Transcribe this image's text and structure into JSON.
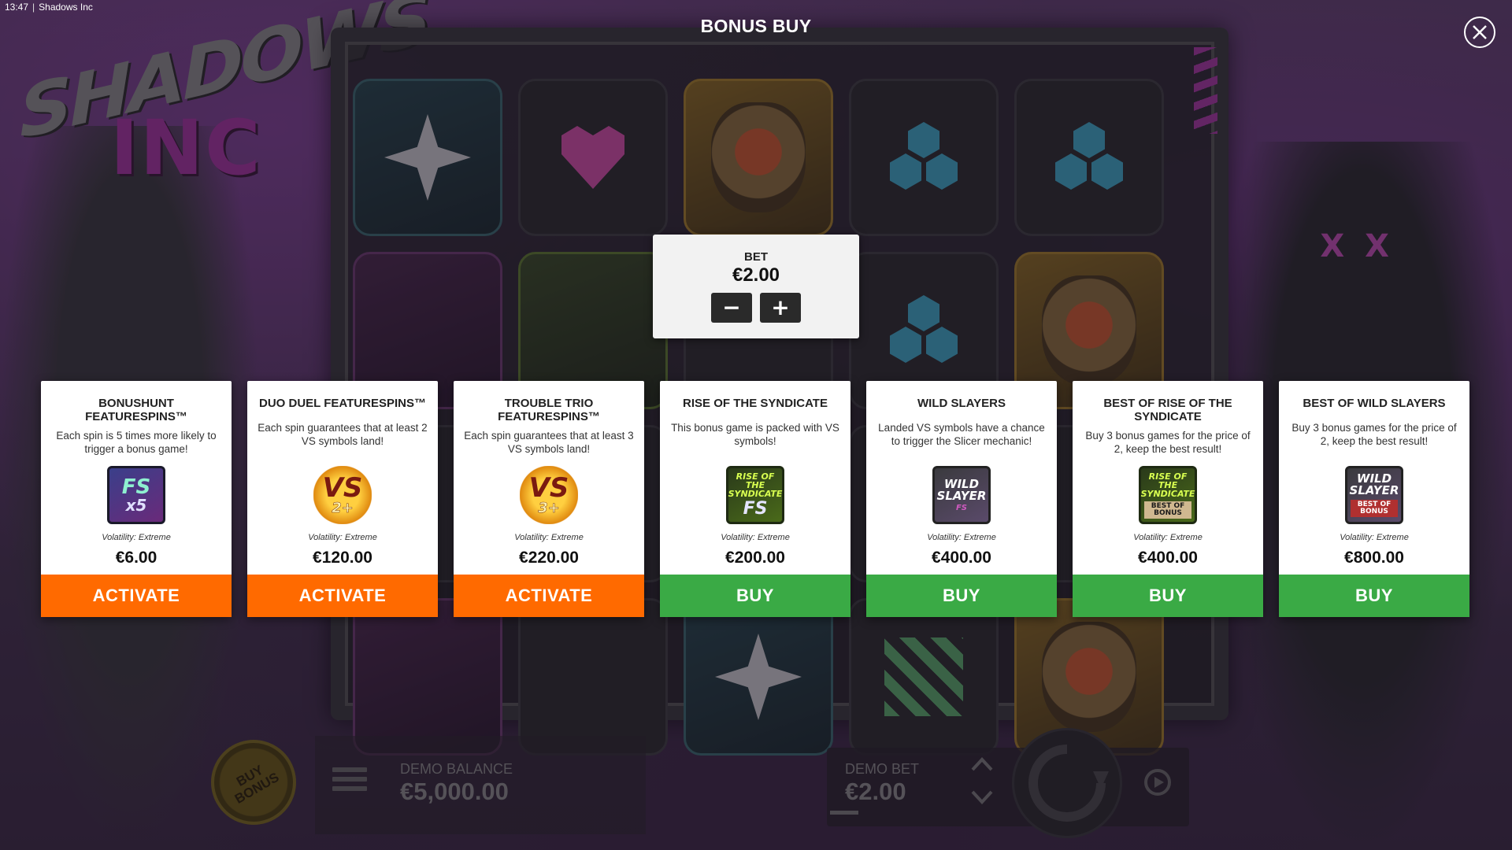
{
  "status_bar": {
    "time": "13:47",
    "app_name": "Shadows Inc"
  },
  "game_logo": {
    "line1": "SHADOWS",
    "line2": "INC"
  },
  "title": "BONUS BUY",
  "bet": {
    "label": "BET",
    "value": "€2.00",
    "decrease_icon": "minus-icon",
    "increase_icon": "plus-icon"
  },
  "cards": [
    {
      "title": "BONUSHUNT FEATURESPINS™",
      "description": "Each spin is 5 times more likely to trigger a bonus game!",
      "icon_main": "FS",
      "icon_sub": "x5",
      "volatility": "Volatility: Extreme",
      "price": "€6.00",
      "button": "ACTIVATE"
    },
    {
      "title": "DUO DUEL FEATURESPINS™",
      "description": "Each spin guarantees that at least 2 VS symbols land!",
      "icon_main": "VS",
      "icon_sub": "2+",
      "volatility": "Volatility: Extreme",
      "price": "€120.00",
      "button": "ACTIVATE"
    },
    {
      "title": "TROUBLE TRIO FEATURESPINS™",
      "description": "Each spin guarantees that at least 3 VS symbols land!",
      "icon_main": "VS",
      "icon_sub": "3+",
      "volatility": "Volatility: Extreme",
      "price": "€220.00",
      "button": "ACTIVATE"
    },
    {
      "title": "RISE OF THE SYNDICATE",
      "description": "This bonus game is packed with VS symbols!",
      "icon_main": "RISE OF THE SYNDICATE",
      "icon_sub": "FS",
      "volatility": "Volatility: Extreme",
      "price": "€200.00",
      "button": "BUY"
    },
    {
      "title": "WILD SLAYERS",
      "description": "Landed VS symbols have a chance to trigger the Slicer mechanic!",
      "icon_main": "WILD SLAYER",
      "icon_sub": "FS",
      "volatility": "Volatility: Extreme",
      "price": "€400.00",
      "button": "BUY"
    },
    {
      "title": "BEST OF RISE OF THE SYNDICATE",
      "description": "Buy 3 bonus games for the price of 2, keep the best result!",
      "icon_main": "RISE OF THE SYNDICATE",
      "icon_sub": "BEST OF BONUS",
      "volatility": "Volatility: Extreme",
      "price": "€400.00",
      "button": "BUY"
    },
    {
      "title": "BEST OF WILD SLAYERS",
      "description": "Buy 3 bonus games for the price of 2, keep the best result!",
      "icon_main": "WILD SLAYER",
      "icon_sub": "BEST OF BONUS",
      "volatility": "Volatility: Extreme",
      "price": "€800.00",
      "button": "BUY"
    }
  ],
  "bottom_bar": {
    "buy_bonus": "BUY BONUS",
    "demo_balance_label": "DEMO BALANCE",
    "demo_balance_value": "€5,000.00",
    "demo_bet_label": "DEMO BET",
    "demo_bet_value": "€2.00"
  },
  "colors": {
    "activate": "#ff6a00",
    "buy": "#3aaa45",
    "accent_purple": "#a2359e"
  },
  "icons": [
    "close-icon",
    "minus-icon",
    "plus-icon",
    "menu-icon",
    "chevron-up-icon",
    "chevron-down-icon",
    "spin-icon",
    "autoplay-icon"
  ]
}
